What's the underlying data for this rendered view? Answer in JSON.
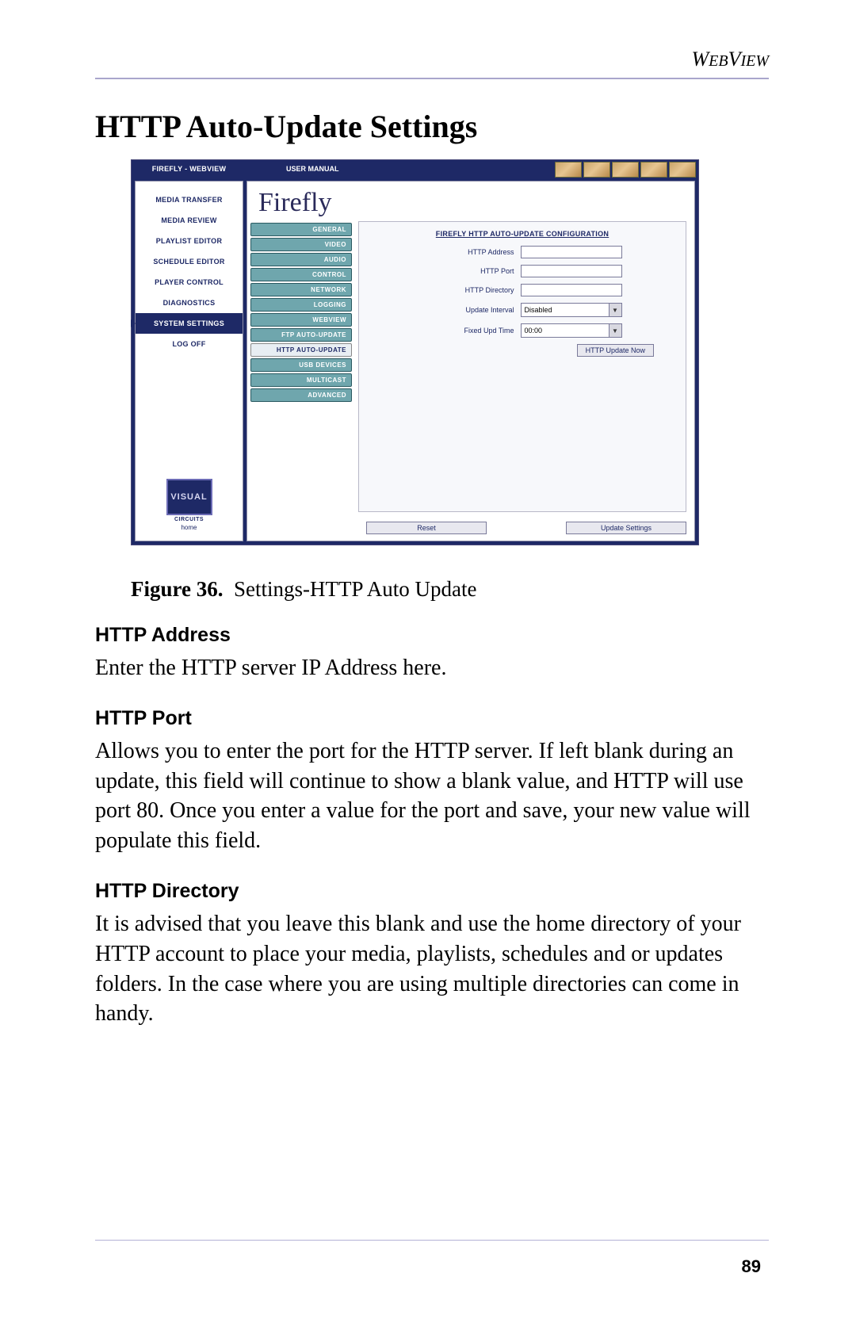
{
  "runningHead": "WEBVIEW",
  "sectionTitle": "HTTP Auto-Update Settings",
  "pageNumber": "89",
  "caption": {
    "label": "Figure 36.",
    "text": "Settings-HTTP Auto Update"
  },
  "paras": {
    "h1": "HTTP Address",
    "p1": "Enter the HTTP server IP Address here.",
    "h2": "HTTP Port",
    "p2": "Allows you to enter the port for the HTTP server. If left blank during an update, this field will continue to show a blank value, and HTTP will use port 80. Once you enter a value for the port and save, your new value will populate this field.",
    "h3": "HTTP Directory",
    "p3": "It is advised that you leave this blank and use the home directory of your HTTP account to place your media, playlists, schedules and or updates folders. In the case where you are using multiple directories can come in handy."
  },
  "app": {
    "title": "FIREFLY - WEBVIEW",
    "manual": "USER MANUAL",
    "brand": "Firefly",
    "logo": {
      "main": "VISUAL",
      "sub": "CIRCUITS",
      "home": "home"
    }
  },
  "sidebar": [
    {
      "label": "MEDIA TRANSFER",
      "active": false
    },
    {
      "label": "MEDIA REVIEW",
      "active": false
    },
    {
      "label": "PLAYLIST EDITOR",
      "active": false
    },
    {
      "label": "SCHEDULE EDITOR",
      "active": false
    },
    {
      "label": "PLAYER CONTROL",
      "active": false
    },
    {
      "label": "DIAGNOSTICS",
      "active": false
    },
    {
      "label": "SYSTEM SETTINGS",
      "active": true
    },
    {
      "label": "LOG OFF",
      "active": false
    }
  ],
  "subtabs": [
    {
      "label": "GENERAL"
    },
    {
      "label": "VIDEO"
    },
    {
      "label": "AUDIO"
    },
    {
      "label": "CONTROL"
    },
    {
      "label": "NETWORK"
    },
    {
      "label": "LOGGING"
    },
    {
      "label": "WEBVIEW"
    },
    {
      "label": "FTP AUTO-UPDATE"
    },
    {
      "label": "HTTP AUTO-UPDATE",
      "active": true
    },
    {
      "label": "USB DEVICES"
    },
    {
      "label": "MULTICAST"
    },
    {
      "label": "ADVANCED"
    }
  ],
  "form": {
    "title": "FIREFLY HTTP AUTO-UPDATE CONFIGURATION",
    "rows": {
      "addr": {
        "label": "HTTP Address",
        "value": ""
      },
      "port": {
        "label": "HTTP Port",
        "value": ""
      },
      "dir": {
        "label": "HTTP Directory",
        "value": ""
      },
      "interval": {
        "label": "Update Interval",
        "value": "Disabled"
      },
      "fixed": {
        "label": "Fixed Upd Time",
        "value": "00:00"
      }
    },
    "updateNow": "HTTP Update Now",
    "reset": "Reset",
    "updateSettings": "Update Settings"
  }
}
